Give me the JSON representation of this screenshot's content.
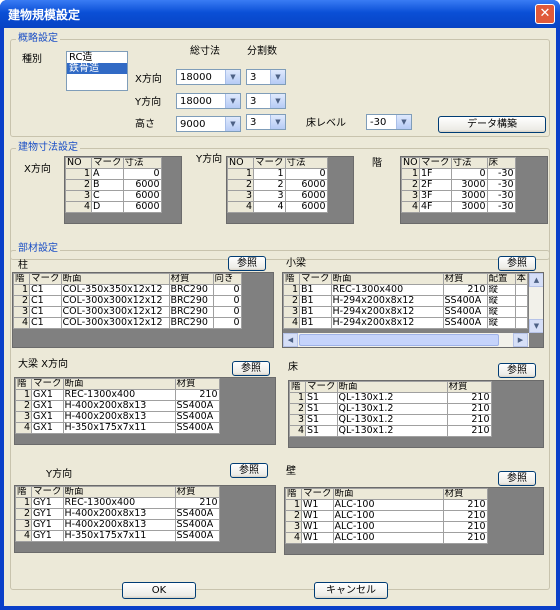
{
  "window": {
    "title": "建物規模設定",
    "close_glyph": "✕"
  },
  "overview": {
    "group_label": "概略設定",
    "type_label": "種別",
    "type_options": [
      "RC造",
      "鉄骨造"
    ],
    "col_total_label": "総寸法",
    "col_div_label": "分割数",
    "x_label": "X方向",
    "y_label": "Y方向",
    "h_label": "高さ",
    "x_total": "18000",
    "x_div": "3",
    "y_total": "18000",
    "y_div": "3",
    "h_total": "9000",
    "h_div": "3",
    "floor_level_label": "床レベル",
    "floor_level": "-30",
    "build_button": "データ構築"
  },
  "dims": {
    "group_label": "建物寸法設定",
    "x_label": "X方向",
    "y_label": "Y方向",
    "floor_label": "階",
    "x_table": {
      "headers": [
        "NO",
        "マーク",
        "寸法"
      ],
      "rows": [
        [
          "1",
          "A",
          "0"
        ],
        [
          "2",
          "B",
          "6000"
        ],
        [
          "3",
          "C",
          "6000"
        ],
        [
          "4",
          "D",
          "6000"
        ]
      ]
    },
    "y_table": {
      "headers": [
        "NO",
        "マーク",
        "寸法"
      ],
      "rows": [
        [
          "1",
          "1",
          "0"
        ],
        [
          "2",
          "2",
          "6000"
        ],
        [
          "3",
          "3",
          "6000"
        ],
        [
          "4",
          "4",
          "6000"
        ]
      ]
    },
    "floor_table": {
      "headers": [
        "NO",
        "マーク",
        "寸法",
        "床"
      ],
      "rows": [
        [
          "1",
          "1F",
          "0",
          "-30"
        ],
        [
          "2",
          "2F",
          "3000",
          "-30"
        ],
        [
          "3",
          "3F",
          "3000",
          "-30"
        ],
        [
          "4",
          "4F",
          "3000",
          "-30"
        ]
      ]
    }
  },
  "members": {
    "group_label": "部材設定",
    "ref_button": "参照",
    "column": {
      "label": "柱",
      "headers": [
        "階",
        "マーク",
        "断面",
        "材質",
        "向き"
      ],
      "rows": [
        [
          "1",
          "C1",
          "COL-350x350x12x12",
          "BRC290",
          "0"
        ],
        [
          "2",
          "C1",
          "COL-300x300x12x12",
          "BRC290",
          "0"
        ],
        [
          "3",
          "C1",
          "COL-300x300x12x12",
          "BRC290",
          "0"
        ],
        [
          "4",
          "C1",
          "COL-300x300x12x12",
          "BRC290",
          "0"
        ]
      ]
    },
    "small_beam": {
      "label": "小梁",
      "headers": [
        "階",
        "マーク",
        "断面",
        "材質",
        "配置",
        "本"
      ],
      "rows": [
        [
          "1",
          "B1",
          "REC-1300x400",
          "210",
          "縦",
          ""
        ],
        [
          "2",
          "B1",
          "H-294x200x8x12",
          "SS400A",
          "縦",
          ""
        ],
        [
          "3",
          "B1",
          "H-294x200x8x12",
          "SS400A",
          "縦",
          ""
        ],
        [
          "4",
          "B1",
          "H-294x200x8x12",
          "SS400A",
          "縦",
          ""
        ]
      ]
    },
    "beam_x": {
      "label": "大梁 X方向",
      "headers": [
        "階",
        "マーク",
        "断面",
        "材質"
      ],
      "rows": [
        [
          "1",
          "GX1",
          "REC-1300x400",
          "210"
        ],
        [
          "2",
          "GX1",
          "H-400x200x8x13",
          "SS400A"
        ],
        [
          "3",
          "GX1",
          "H-400x200x8x13",
          "SS400A"
        ],
        [
          "4",
          "GX1",
          "H-350x175x7x11",
          "SS400A"
        ]
      ]
    },
    "floor_slab": {
      "label": "床",
      "headers": [
        "階",
        "マーク",
        "断面",
        "材質"
      ],
      "rows": [
        [
          "1",
          "S1",
          "QL-130x1.2",
          "210"
        ],
        [
          "2",
          "S1",
          "QL-130x1.2",
          "210"
        ],
        [
          "3",
          "S1",
          "QL-130x1.2",
          "210"
        ],
        [
          "4",
          "S1",
          "QL-130x1.2",
          "210"
        ]
      ]
    },
    "beam_y": {
      "label": "Y方向",
      "headers": [
        "階",
        "マーク",
        "断面",
        "材質"
      ],
      "rows": [
        [
          "1",
          "GY1",
          "REC-1300x400",
          "210"
        ],
        [
          "2",
          "GY1",
          "H-400x200x8x13",
          "SS400A"
        ],
        [
          "3",
          "GY1",
          "H-400x200x8x13",
          "SS400A"
        ],
        [
          "4",
          "GY1",
          "H-350x175x7x11",
          "SS400A"
        ]
      ]
    },
    "wall": {
      "label": "壁",
      "headers": [
        "階",
        "マーク",
        "断面",
        "材質"
      ],
      "rows": [
        [
          "1",
          "W1",
          "ALC-100",
          "210"
        ],
        [
          "2",
          "W1",
          "ALC-100",
          "210"
        ],
        [
          "3",
          "W1",
          "ALC-100",
          "210"
        ],
        [
          "4",
          "W1",
          "ALC-100",
          "210"
        ]
      ]
    }
  },
  "footer": {
    "ok": "OK",
    "cancel": "キャンセル"
  }
}
